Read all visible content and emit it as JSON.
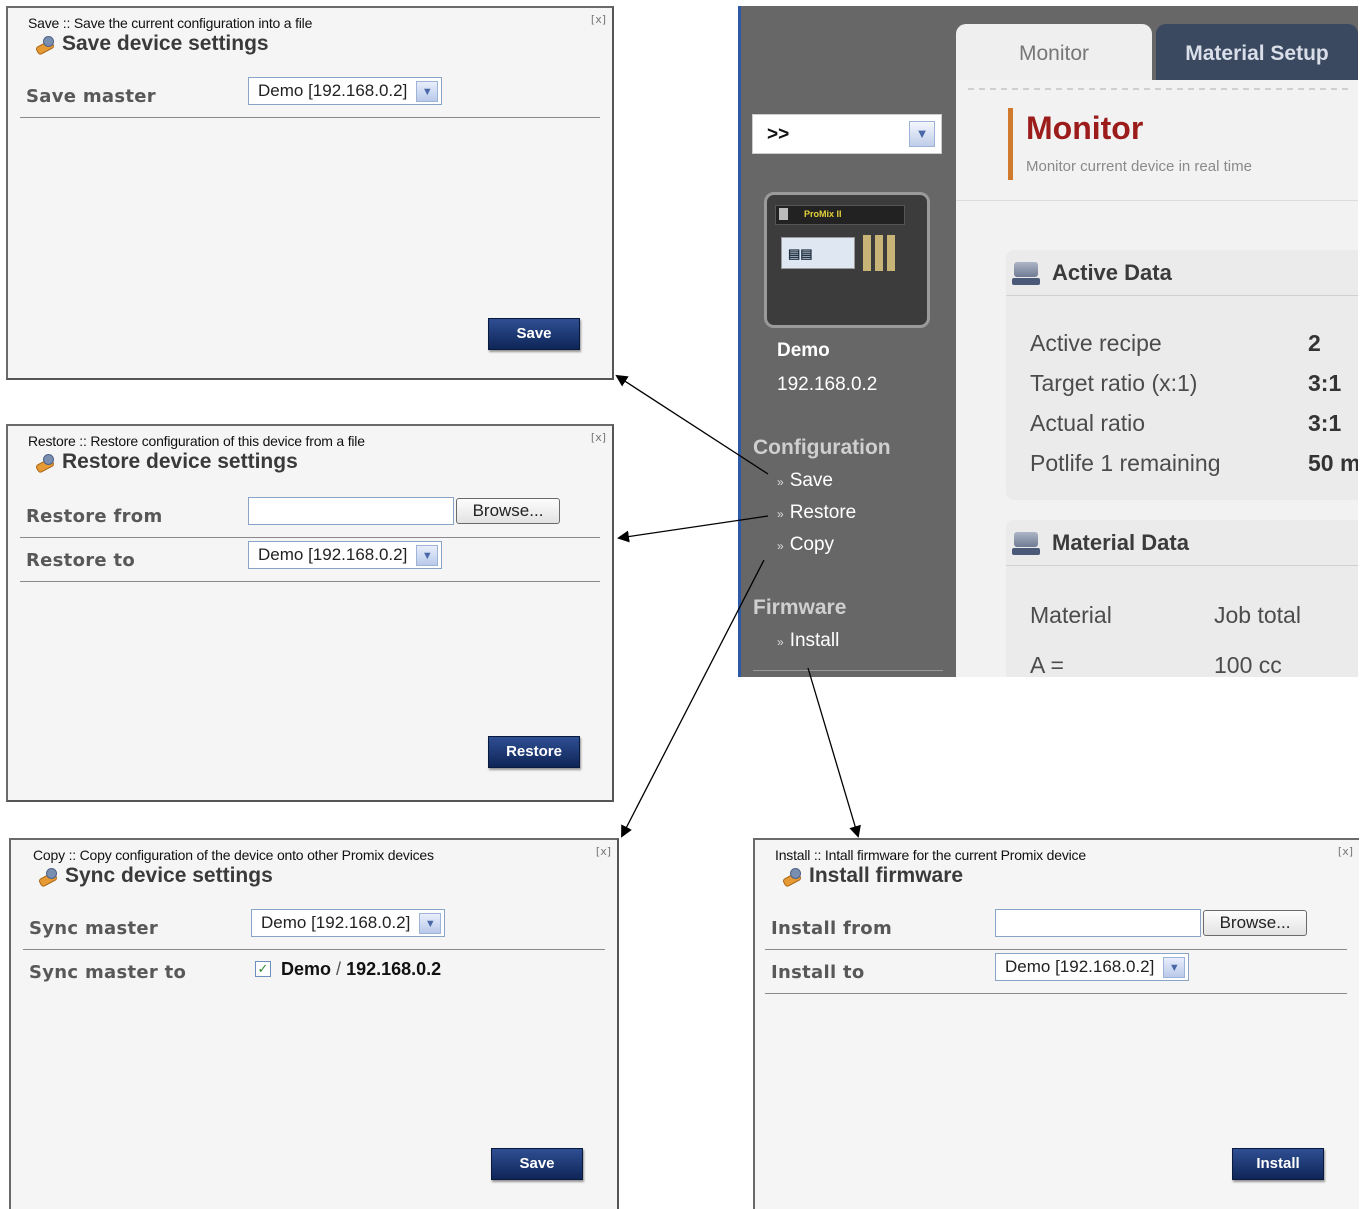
{
  "dialogs": {
    "save": {
      "subtitle": "Save :: Save the current configuration into a file",
      "close": "[x]",
      "title": "Save device settings",
      "row1_label": "Save master",
      "row1_select": "Demo [192.168.0.2]",
      "button": "Save"
    },
    "restore": {
      "subtitle": "Restore :: Restore configuration of this device from a file",
      "close": "[x]",
      "title": "Restore device settings",
      "row1_label": "Restore from",
      "row1_browse": "Browse...",
      "row2_label": "Restore to",
      "row2_select": "Demo [192.168.0.2]",
      "button": "Restore"
    },
    "copy": {
      "subtitle": "Copy :: Copy configuration of the device onto other Promix devices",
      "close": "[x]",
      "title": "Sync device settings",
      "row1_label": "Sync master",
      "row1_select": "Demo [192.168.0.2]",
      "row2_label": "Sync master to",
      "row2_device_name": "Demo",
      "row2_separator": "/",
      "row2_device_ip": "192.168.0.2",
      "checked": true,
      "button": "Save"
    },
    "install": {
      "subtitle": "Install :: Intall firmware for the current Promix device",
      "close": "[x]",
      "title": "Install firmware",
      "row1_label": "Install from",
      "row1_browse": "Browse...",
      "row2_label": "Install to",
      "row2_select": "Demo [192.168.0.2]",
      "button": "Install"
    }
  },
  "app": {
    "device_select": ">>",
    "device_screen_text": "ProMix II",
    "device_name": "Demo",
    "device_ip": "192.168.0.2",
    "sidebar": {
      "configuration_heading": "Configuration",
      "save": "Save",
      "restore": "Restore",
      "copy": "Copy",
      "firmware_heading": "Firmware",
      "install": "Install"
    },
    "tabs": [
      "Monitor",
      "Material Setup"
    ],
    "monitor": {
      "title": "Monitor",
      "subtitle": "Monitor current device in real time"
    },
    "active_data": {
      "heading": "Active Data",
      "rows": [
        {
          "label": "Active recipe",
          "value": "2"
        },
        {
          "label": "Target ratio (x:1)",
          "value": "3:1"
        },
        {
          "label": "Actual ratio",
          "value": "3:1"
        },
        {
          "label": "Potlife 1 remaining",
          "value": "50 m"
        }
      ]
    },
    "material_data": {
      "heading": "Material Data",
      "col1": "Material",
      "col2": "Job total",
      "row1_label": "A =",
      "row1_value": "100 cc"
    }
  },
  "colors": {
    "button_blue": "#1a3570",
    "monitor_red": "#9c1c1c",
    "sidebar_gray": "#666766",
    "accent_orange": "#d07a2d"
  }
}
